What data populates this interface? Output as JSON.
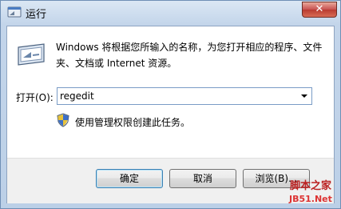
{
  "window": {
    "title": "运行",
    "close_glyph": "✕"
  },
  "dialog": {
    "description": "Windows 将根据您所输入的名称，为您打开相应的程序、文件夹、文档或 Internet 资源。",
    "open_label": "打开(O):",
    "open_value": "regedit",
    "admin_note": "使用管理权限创建此任务。"
  },
  "buttons": {
    "ok": "确定",
    "cancel": "取消",
    "browse": "浏览(B)..."
  },
  "watermark": {
    "line1": "脚本之家",
    "line2": "JB51.Net"
  },
  "icons": [
    "run-app-icon",
    "run-dialog-icon",
    "dropdown-arrow-icon",
    "uac-shield-icon"
  ],
  "colors": {
    "accent": "#3c7fb1",
    "title_bg": "#c3d5ea",
    "footer_bg": "#f0f0f0",
    "close": "#c75050"
  }
}
